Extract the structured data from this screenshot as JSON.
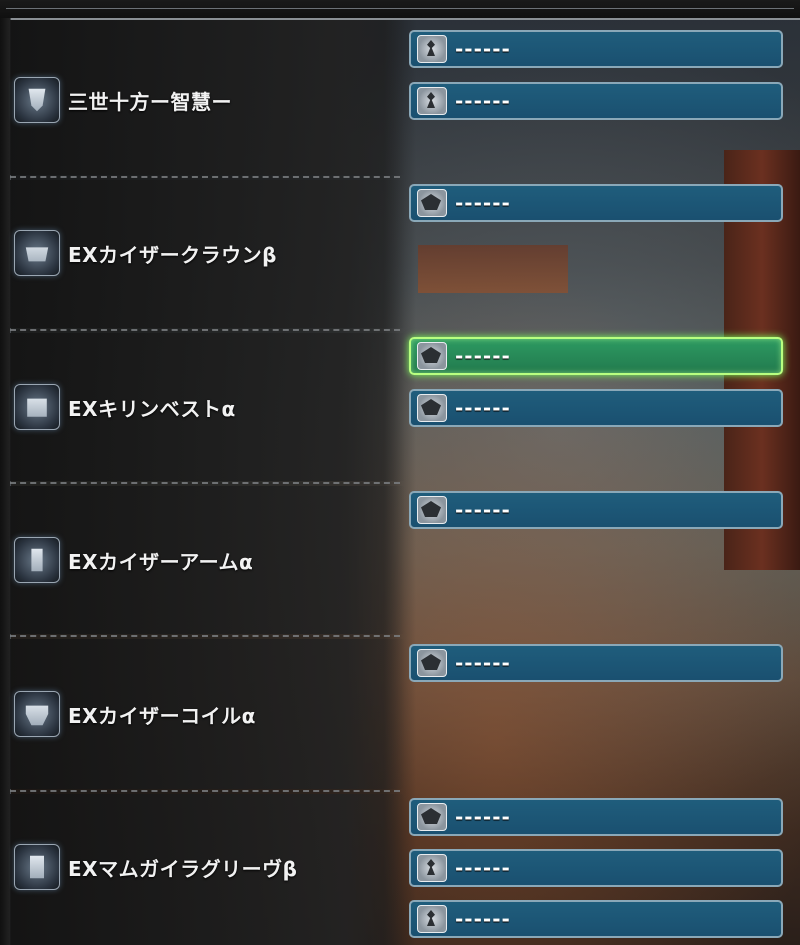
{
  "colors": {
    "slot_fill": "#1f5d7c",
    "slot_selected_fill": "#2d9a62",
    "selected_glow": "#7cff5a"
  },
  "equipment": [
    {
      "name": "三世十方ー智慧ー",
      "icon": "charm-icon",
      "slots": [
        {
          "icon": "small-deco-icon",
          "text": "------"
        },
        {
          "icon": "small-deco-icon",
          "text": "------"
        }
      ]
    },
    {
      "name": "EXカイザークラウンβ",
      "icon": "helm-icon",
      "slots": [
        {
          "icon": "large-deco-icon",
          "text": "------"
        }
      ]
    },
    {
      "name": "EXキリンベストα",
      "icon": "chest-icon",
      "slots": [
        {
          "icon": "large-deco-icon",
          "text": "------",
          "selected": true
        },
        {
          "icon": "large-deco-icon",
          "text": "------"
        }
      ]
    },
    {
      "name": "EXカイザーアームα",
      "icon": "arm-icon",
      "slots": [
        {
          "icon": "large-deco-icon",
          "text": "------"
        }
      ]
    },
    {
      "name": "EXカイザーコイルα",
      "icon": "waist-icon",
      "slots": [
        {
          "icon": "large-deco-icon",
          "text": "------"
        }
      ]
    },
    {
      "name": "EXマムガイラグリーヴβ",
      "icon": "legs-icon",
      "slots": [
        {
          "icon": "large-deco-icon",
          "text": "------"
        },
        {
          "icon": "small-deco-icon",
          "text": "------"
        },
        {
          "icon": "small-deco-icon",
          "text": "------"
        }
      ]
    }
  ]
}
